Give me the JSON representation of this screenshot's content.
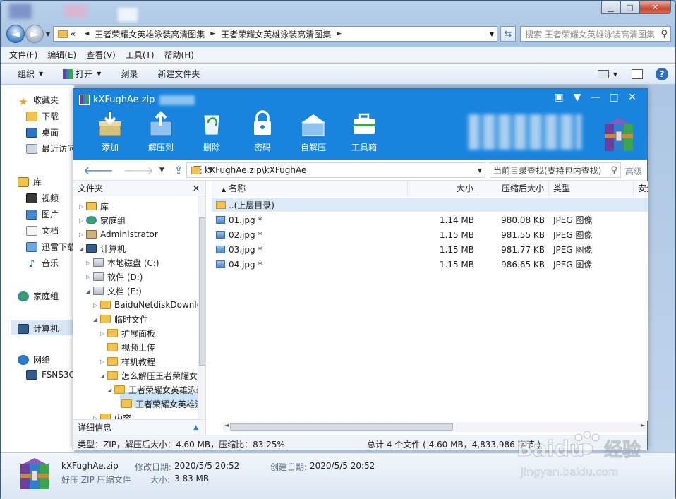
{
  "explorer": {
    "breadcrumb_overflow": "«",
    "breadcrumb": [
      "王者荣耀女英雄泳装高清图集",
      "王者荣耀女英雄泳装高清图集"
    ],
    "search_placeholder": "搜索 王者荣耀女英雄泳装高清图集",
    "menu": [
      "文件(F)",
      "编辑(E)",
      "查看(V)",
      "工具(T)",
      "帮助(H)"
    ],
    "toolbar": {
      "organize": "组织",
      "open": "打开",
      "burn": "刻录",
      "new_folder": "新建文件夹"
    },
    "nav": {
      "favorites": "收藏夹",
      "downloads": "下载",
      "desktop": "桌面",
      "recent": "最近访问",
      "libraries": "库",
      "videos": "视频",
      "pictures": "图片",
      "documents": "文档",
      "thunder_dl": "迅雷下载",
      "music": "音乐",
      "homegroup": "家庭组",
      "computer": "计算机",
      "network": "网络",
      "net_pc": "FSNS3C"
    },
    "details": {
      "file_name": "kXFughAe.zip",
      "file_type": "好压 ZIP 压缩文件",
      "modified_label": "修改日期:",
      "modified_value": "2020/5/5 20:52",
      "created_label": "创建日期:",
      "created_value": "2020/5/5 20:52",
      "size_label": "大小:",
      "size_value": "3.83 MB"
    }
  },
  "zip": {
    "title": "kXFughAe.zip",
    "tools": [
      {
        "label": "添加",
        "icon": "add-icon"
      },
      {
        "label": "解压到",
        "icon": "extract-to-icon"
      },
      {
        "label": "删除",
        "icon": "delete-icon"
      },
      {
        "label": "密码",
        "icon": "lock-icon"
      },
      {
        "label": "自解压",
        "icon": "self-extract-icon"
      },
      {
        "label": "工具箱",
        "icon": "toolbox-icon"
      }
    ],
    "path": "kXFughAe.zip\\kXFughAe",
    "search_placeholder": "当前目录查找(支持包内查找)",
    "advanced": "高级",
    "tree": {
      "header": "文件夹",
      "details": "详细信息",
      "items": [
        {
          "label": "库"
        },
        {
          "label": "家庭组"
        },
        {
          "label": "Administrator"
        },
        {
          "label": "计算机"
        },
        {
          "label": "本地磁盘 (C:)"
        },
        {
          "label": "软件 (D:)"
        },
        {
          "label": "文档 (E:)"
        },
        {
          "label": "BaiduNetdiskDownload"
        },
        {
          "label": "临时文件"
        },
        {
          "label": "扩展面板"
        },
        {
          "label": "视频上传"
        },
        {
          "label": "样机教程"
        },
        {
          "label": "怎么解压王者荣耀女英雄泳装高清图集"
        },
        {
          "label": "王者荣耀女英雄泳装高清图集"
        },
        {
          "label": "王者荣耀女英雄泳装高清图集"
        },
        {
          "label": "内容"
        }
      ]
    },
    "columns": {
      "name": "名称",
      "size": "大小",
      "packed": "压缩后大小",
      "type": "类型",
      "security": "安全"
    },
    "up_dir": "..(上层目录)",
    "files": [
      {
        "name": "01.jpg *",
        "size": "1.14 MB",
        "packed": "980.08 KB",
        "type": "JPEG 图像"
      },
      {
        "name": "02.jpg *",
        "size": "1.15 MB",
        "packed": "981.55 KB",
        "type": "JPEG 图像"
      },
      {
        "name": "03.jpg *",
        "size": "1.15 MB",
        "packed": "981.77 KB",
        "type": "JPEG 图像"
      },
      {
        "name": "04.jpg *",
        "size": "1.15 MB",
        "packed": "986.65 KB",
        "type": "JPEG 图像"
      }
    ],
    "status_left": "类型：ZIP，解压后大小：4.60 MB，压缩比：83.25%",
    "status_right": "总计 4 个文件 ( 4.60 MB，4,833,986 字节 )"
  },
  "watermark": {
    "brand": "Baidu",
    "brand_cn": "经验",
    "url": "jingyan.baidu.com"
  }
}
